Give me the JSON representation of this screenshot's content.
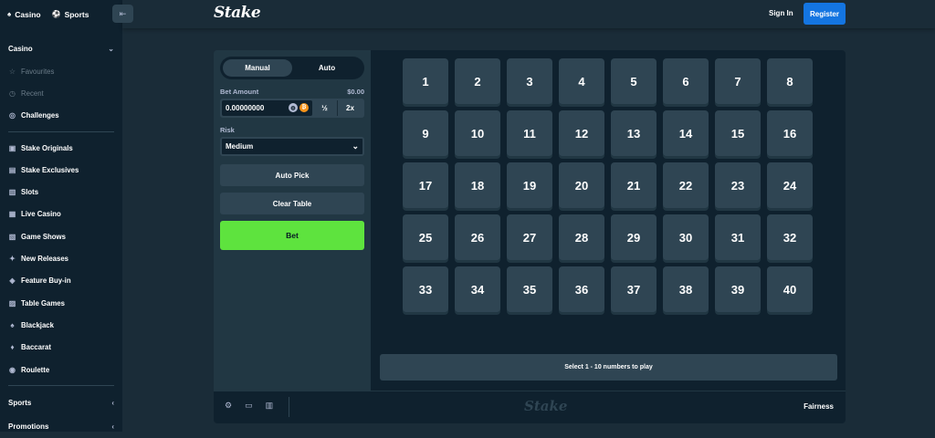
{
  "nav": {
    "casino_tab": "Casino",
    "sports_tab": "Sports"
  },
  "header": {
    "logo": "Stake",
    "signin": "Sign In",
    "register": "Register"
  },
  "sidebar": {
    "casino_heading": "Casino",
    "top_items": [
      {
        "label": "Favourites",
        "icon": "☆"
      },
      {
        "label": "Recent",
        "icon": "◷"
      },
      {
        "label": "Challenges",
        "icon": "◎"
      }
    ],
    "game_items": [
      {
        "label": "Stake Originals",
        "icon": "▣"
      },
      {
        "label": "Stake Exclusives",
        "icon": "▤"
      },
      {
        "label": "Slots",
        "icon": "▥"
      },
      {
        "label": "Live Casino",
        "icon": "▦"
      },
      {
        "label": "Game Shows",
        "icon": "▧"
      },
      {
        "label": "New Releases",
        "icon": "✦"
      },
      {
        "label": "Feature Buy-in",
        "icon": "◈"
      },
      {
        "label": "Table Games",
        "icon": "▨"
      },
      {
        "label": "Blackjack",
        "icon": "♠"
      },
      {
        "label": "Baccarat",
        "icon": "♦"
      },
      {
        "label": "Roulette",
        "icon": "◉"
      }
    ],
    "sports_heading": "Sports",
    "promotions_heading": "Promotions"
  },
  "panel": {
    "manual": "Manual",
    "auto": "Auto",
    "bet_amount_label": "Bet Amount",
    "bet_amount_usd": "$0.00",
    "bet_amount_value": "0.00000000",
    "half": "½",
    "double": "2x",
    "risk_label": "Risk",
    "risk_value": "Medium",
    "auto_pick": "Auto Pick",
    "clear_table": "Clear Table",
    "bet": "Bet"
  },
  "board": {
    "numbers": [
      "1",
      "2",
      "3",
      "4",
      "5",
      "6",
      "7",
      "8",
      "9",
      "10",
      "11",
      "12",
      "13",
      "14",
      "15",
      "16",
      "17",
      "18",
      "19",
      "20",
      "21",
      "22",
      "23",
      "24",
      "25",
      "26",
      "27",
      "28",
      "29",
      "30",
      "31",
      "32",
      "33",
      "34",
      "35",
      "36",
      "37",
      "38",
      "39",
      "40"
    ],
    "hint": "Select 1 - 10 numbers to play"
  },
  "footer": {
    "logo": "Stake",
    "fairness": "Fairness"
  },
  "colors": {
    "accent_green": "#5ee33e",
    "accent_blue": "#1475e1",
    "tile": "#2f4553",
    "bg_dark": "#0f212e"
  }
}
